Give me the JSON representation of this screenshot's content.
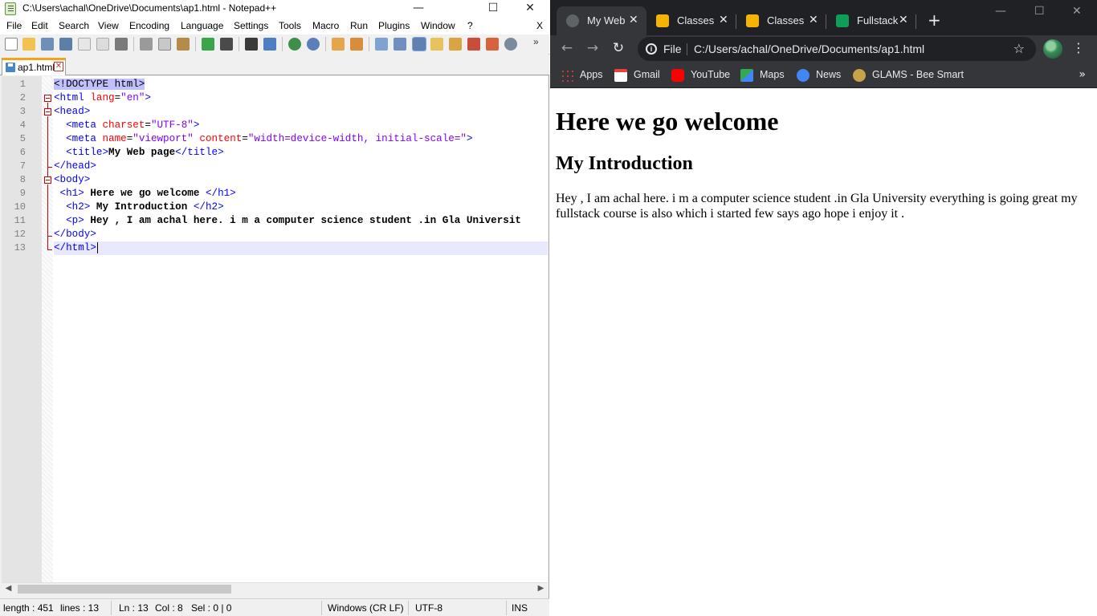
{
  "notepad": {
    "title": "C:\\Users\\achal\\OneDrive\\Documents\\ap1.html - Notepad++",
    "window_buttons": [
      "—",
      "☐",
      "✕"
    ],
    "menu": [
      "File",
      "Edit",
      "Search",
      "View",
      "Encoding",
      "Language",
      "Settings",
      "Tools",
      "Macro",
      "Run",
      "Plugins",
      "Window",
      "?"
    ],
    "menu_close": "X",
    "tab": {
      "label": "ap1.html",
      "close": "✕"
    },
    "line_numbers": [
      "1",
      "2",
      "3",
      "4",
      "5",
      "6",
      "7",
      "8",
      "9",
      "10",
      "11",
      "12",
      "13"
    ],
    "code": {
      "l1_doctype": "<!DOCTYPE html>",
      "l2_open": "<html ",
      "l2_attr": "lang",
      "l2_eq": "=",
      "l2_val": "\"en\"",
      "l2_close": ">",
      "l3": "<head>",
      "l4_open": "  <meta ",
      "l4_attr": "charset",
      "l4_eq": "=",
      "l4_val": "\"UTF-8\"",
      "l4_close": ">",
      "l5_open": "  <meta ",
      "l5_attr1": "name",
      "l5_eq1": "=",
      "l5_val1": "\"viewport\"",
      "l5_sp": " ",
      "l5_attr2": "content",
      "l5_eq2": "=",
      "l5_val2": "\"width=device-width, initial-scale=\"",
      "l5_close": ">",
      "l6_open": "  <title>",
      "l6_text": "My Web page",
      "l6_close": "</title>",
      "l7": "</head>",
      "l8": "<body>",
      "l9_open": " <h1>",
      "l9_text": " Here we go welcome ",
      "l9_close": "</h1>",
      "l10_open": "  <h2>",
      "l10_text": " My Introduction ",
      "l10_close": "</h2>",
      "l11_open": "  <p>",
      "l11_text": " Hey , I am achal here. i m a computer science student .in Gla Universit",
      "l12": "</body>",
      "l13": "</html>"
    },
    "status": {
      "length": "length : 451",
      "lines": "lines : 13",
      "ln": "Ln : 13",
      "col": "Col : 8",
      "sel": "Sel : 0 | 0",
      "eol": "Windows (CR LF)",
      "encoding": "UTF-8",
      "mode": "INS"
    }
  },
  "chrome": {
    "tabs": [
      {
        "label": "My Web",
        "active": true,
        "favicon_color": "#5f6368"
      },
      {
        "label": "Classes",
        "active": false,
        "favicon_color": "#f4b400"
      },
      {
        "label": "Classes",
        "active": false,
        "favicon_color": "#f4b400"
      },
      {
        "label": "Fullstack",
        "active": false,
        "favicon_color": "#0f9d58"
      }
    ],
    "new_tab": "+",
    "window_buttons": [
      "—",
      "☐",
      "✕"
    ],
    "nav": {
      "back": "←",
      "forward": "→",
      "reload": "↻"
    },
    "omnibox": {
      "scheme": "File",
      "url": "C:/Users/achal/OneDrive/Documents/ap1.html",
      "star": "☆"
    },
    "menu": "⋮",
    "bookmarks": [
      {
        "label": "Apps",
        "icon": "apps-grid-icon",
        "color": "#4285f4"
      },
      {
        "label": "Gmail",
        "icon": "gmail-icon",
        "color": "#ea4335"
      },
      {
        "label": "YouTube",
        "icon": "youtube-icon",
        "color": "#ff0000"
      },
      {
        "label": "Maps",
        "icon": "maps-icon",
        "color": "#34a853"
      },
      {
        "label": "News",
        "icon": "news-icon",
        "color": "#4285f4"
      },
      {
        "label": "GLAMS - Bee Smart",
        "icon": "glams-icon",
        "color": "#c8a24a"
      }
    ],
    "bookmarks_more": "»",
    "page": {
      "h1": "Here we go welcome",
      "h2": "My Introduction",
      "p": "Hey , I am achal here. i m a computer science student .in Gla University everything is going great my fullstack course is also which i started few says ago hope i enjoy it ."
    }
  }
}
